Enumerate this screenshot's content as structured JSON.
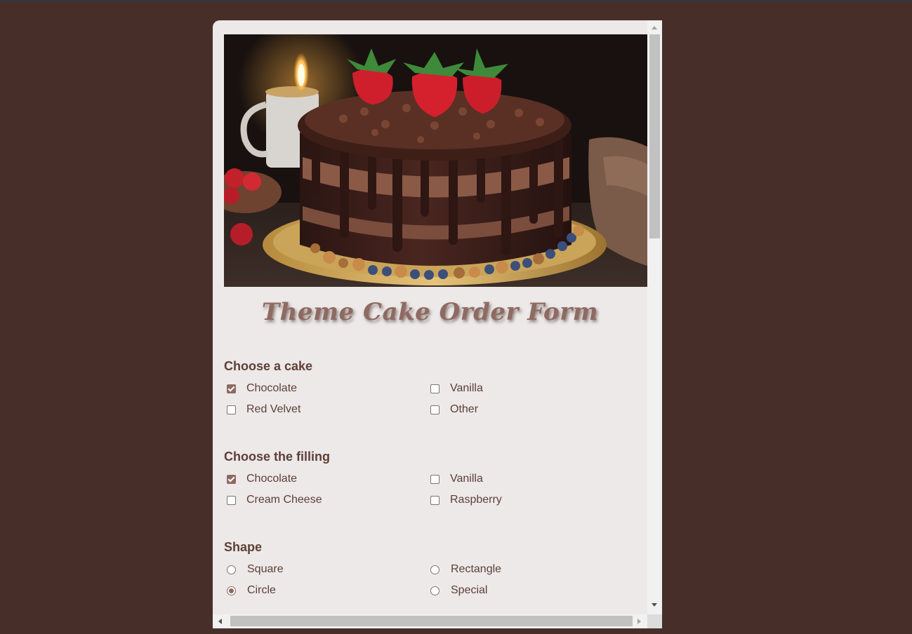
{
  "form": {
    "title": "Theme Cake Order Form",
    "hero_image": "chocolate-drip-cake-with-strawberries"
  },
  "sections": {
    "cake": {
      "heading": "Choose a cake",
      "options": [
        {
          "label": "Chocolate",
          "checked": true
        },
        {
          "label": "Vanilla",
          "checked": false
        },
        {
          "label": "Red Velvet",
          "checked": false
        },
        {
          "label": "Other",
          "checked": false
        }
      ]
    },
    "filling": {
      "heading": "Choose the filling",
      "options": [
        {
          "label": "Chocolate",
          "checked": true
        },
        {
          "label": "Vanilla",
          "checked": false
        },
        {
          "label": "Cream Cheese",
          "checked": false
        },
        {
          "label": "Raspberry",
          "checked": false
        }
      ]
    },
    "shape": {
      "heading": "Shape",
      "selected": "Circle",
      "options": [
        {
          "label": "Square",
          "checked": false
        },
        {
          "label": "Rectangle",
          "checked": false
        },
        {
          "label": "Circle",
          "checked": true
        },
        {
          "label": "Special",
          "checked": false
        }
      ]
    }
  },
  "colors": {
    "page_background": "#482e29",
    "panel_background": "#ece9e8",
    "accent": "#8e6a62",
    "text": "#5e3f38"
  }
}
